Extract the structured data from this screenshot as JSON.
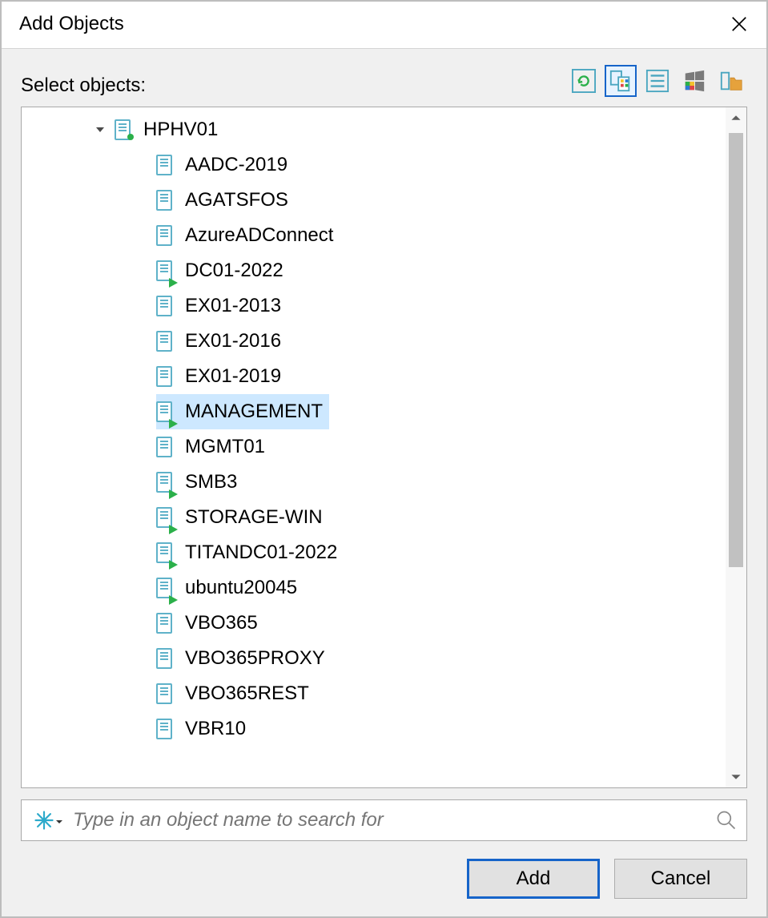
{
  "dialog": {
    "title": "Add Objects",
    "select_label": "Select objects:"
  },
  "toolbar": {
    "icons": [
      {
        "name": "refresh-icon",
        "active": false
      },
      {
        "name": "infrastructure-view-icon",
        "active": true
      },
      {
        "name": "list-view-icon",
        "active": false
      },
      {
        "name": "windows-tags-icon",
        "active": false
      },
      {
        "name": "folder-icon",
        "active": false
      }
    ]
  },
  "tree": {
    "host": {
      "name": "HPHV01",
      "expanded": true
    },
    "vms": [
      {
        "name": "AADC-2019",
        "running": false,
        "selected": false
      },
      {
        "name": "AGATSFOS",
        "running": false,
        "selected": false
      },
      {
        "name": "AzureADConnect",
        "running": false,
        "selected": false
      },
      {
        "name": "DC01-2022",
        "running": true,
        "selected": false
      },
      {
        "name": "EX01-2013",
        "running": false,
        "selected": false
      },
      {
        "name": "EX01-2016",
        "running": false,
        "selected": false
      },
      {
        "name": "EX01-2019",
        "running": false,
        "selected": false
      },
      {
        "name": "MANAGEMENT",
        "running": true,
        "selected": true
      },
      {
        "name": "MGMT01",
        "running": false,
        "selected": false
      },
      {
        "name": "SMB3",
        "running": true,
        "selected": false
      },
      {
        "name": "STORAGE-WIN",
        "running": true,
        "selected": false
      },
      {
        "name": "TITANDC01-2022",
        "running": true,
        "selected": false
      },
      {
        "name": "ubuntu20045",
        "running": true,
        "selected": false
      },
      {
        "name": "VBO365",
        "running": false,
        "selected": false
      },
      {
        "name": "VBO365PROXY",
        "running": false,
        "selected": false
      },
      {
        "name": "VBO365REST",
        "running": false,
        "selected": false
      },
      {
        "name": "VBR10",
        "running": false,
        "selected": false
      }
    ]
  },
  "search": {
    "placeholder": "Type in an object name to search for",
    "value": ""
  },
  "buttons": {
    "add": "Add",
    "cancel": "Cancel"
  }
}
